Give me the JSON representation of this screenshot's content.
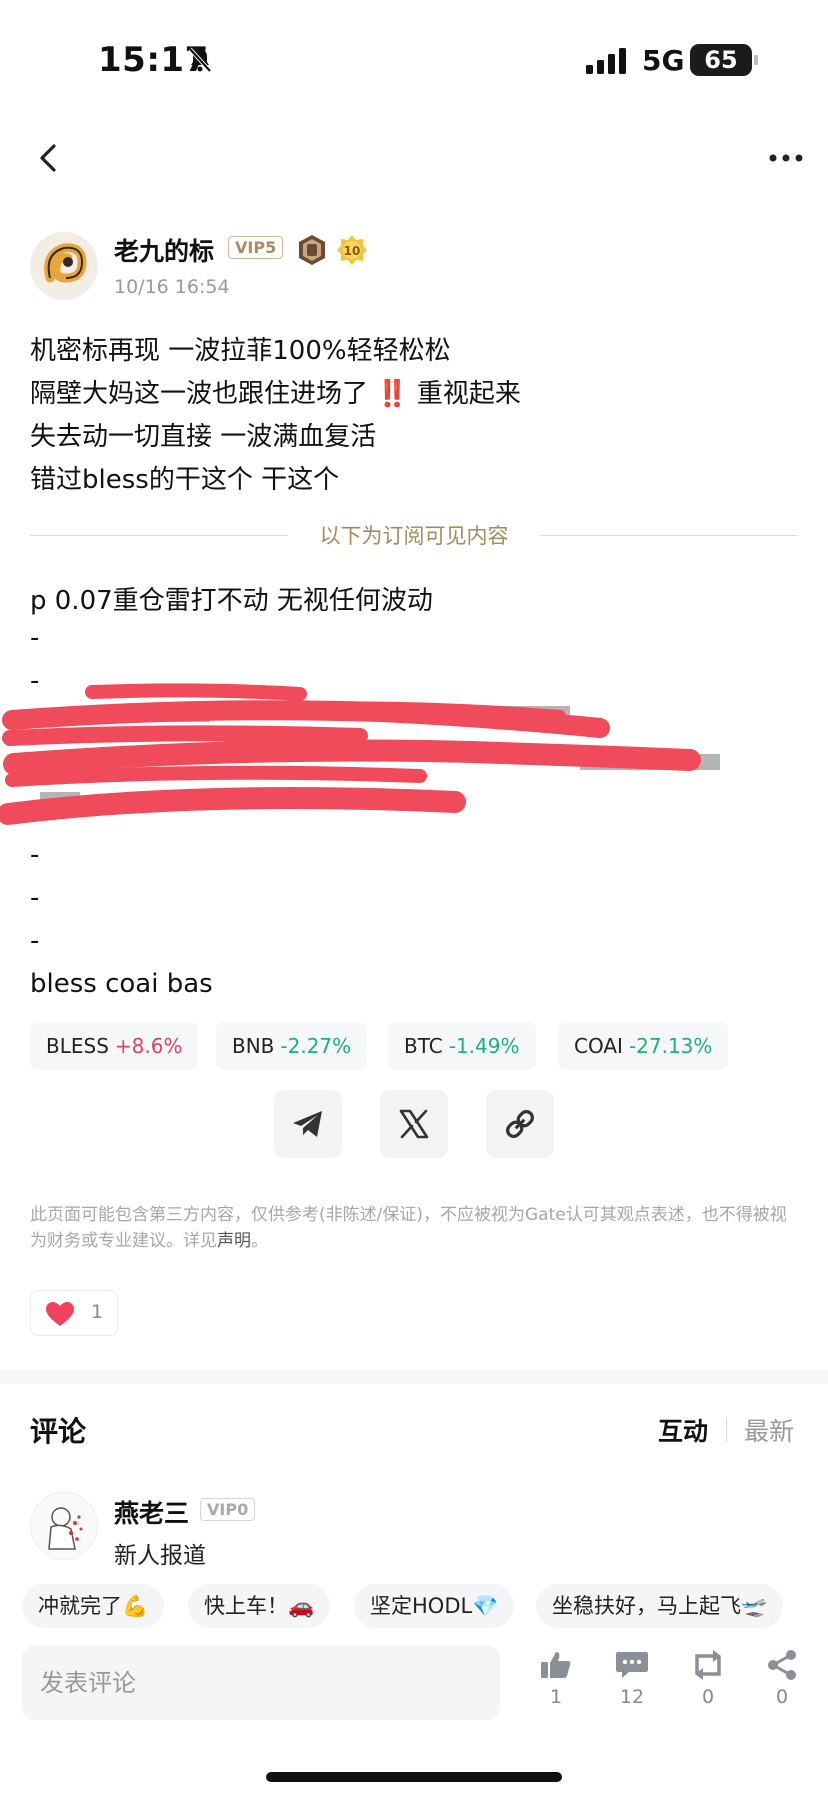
{
  "status_bar": {
    "time": "15:17",
    "network": "5G",
    "battery": "65"
  },
  "post": {
    "author": {
      "name": "老九的标",
      "vip": "VIP5",
      "badge_level": "10"
    },
    "time": "10/16 16:54",
    "lines": [
      "机密标再现 一波拉菲100%轻轻松松",
      "隔壁大妈这一波也跟住进场了",
      "重视起来",
      "失去动一切直接 一波满血复活",
      "错过bless的干这个 干这个"
    ],
    "bang": "‼️",
    "divider_text": "以下为订阅可见内容",
    "sub_lines": [
      "p  0.07重仓雷打不动 无视任何波动",
      "-",
      "-",
      "-",
      "-",
      "-",
      "bless coai bas"
    ],
    "tickers": [
      {
        "symbol": "BLESS",
        "change": "+8.6%",
        "dir": "up"
      },
      {
        "symbol": "BNB",
        "change": "-2.27%",
        "dir": "down"
      },
      {
        "symbol": "BTC",
        "change": "-1.49%",
        "dir": "down"
      },
      {
        "symbol": "COAI",
        "change": "-27.13%",
        "dir": "down"
      }
    ],
    "share_icons": [
      "telegram-icon",
      "x-icon",
      "link-icon"
    ],
    "disclaimer": "此页面可能包含第三方内容，仅供参考(非陈述/保证)，不应被视为Gate认可其观点表述，也不得被视为财务或专业建议。详见",
    "disclaimer_link": "声明",
    "disclaimer_end": "。",
    "likes": "1"
  },
  "comments": {
    "title": "评论",
    "tabs": [
      "互动",
      "最新"
    ],
    "items": [
      {
        "name": "燕老三",
        "vip": "VIP0",
        "text": "新人报道"
      }
    ],
    "quick_replies": [
      "冲就完了💪",
      "快上车！🚗",
      "坚定HODL💎",
      "坐稳扶好，马上起飞🛫"
    ],
    "input_placeholder": "发表评论"
  },
  "actions": {
    "like_count": "1",
    "comment_count": "12",
    "repost_count": "0",
    "share_count": "0"
  },
  "colors": {
    "up": "#e0445a",
    "down": "#1db07a",
    "divider_text": "#a28c5e"
  }
}
